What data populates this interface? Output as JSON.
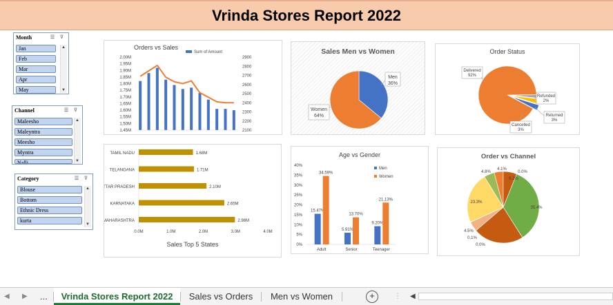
{
  "title": "Vrinda Stores Report 2022",
  "slicers": {
    "month": {
      "title": "Month",
      "items": [
        "Jan",
        "Feb",
        "Mar",
        "Apr",
        "May"
      ]
    },
    "channel": {
      "title": "Channel",
      "items": [
        "Maleesho",
        "Maleyntra",
        "Meesho",
        "Myntra",
        "Nalli"
      ]
    },
    "category": {
      "title": "Category",
      "items": [
        "Blouse",
        "Bottom",
        "Ethnic Dress",
        "kurta"
      ]
    }
  },
  "charts": {
    "orders_vs_sales": {
      "title": "Orders vs Sales",
      "legend": "Sum of Amount",
      "left_ticks": [
        "2.00M",
        "1.95M",
        "1.90M",
        "1.85M",
        "1.80M",
        "1.75M",
        "1.70M",
        "1.65M",
        "1.60M",
        "1.55M",
        "1.50M",
        "1.45M"
      ],
      "right_ticks": [
        "2900",
        "2800",
        "2700",
        "2600",
        "2500",
        "2400",
        "2300",
        "2200",
        "2100"
      ]
    },
    "sales_men_women": {
      "title": "Sales Men vs Women"
    },
    "order_status": {
      "title": "Order Status"
    },
    "top_states": {
      "title": "Sales Top 5 States",
      "x_ticks": [
        "0.0M",
        "1.0M",
        "2.0M",
        "3.0M",
        "4.0M"
      ]
    },
    "age_gender": {
      "title": "Age vs Gender",
      "y_ticks": [
        "40%",
        "35%",
        "30%",
        "25%",
        "20%",
        "15%",
        "10%",
        "5%",
        "0%"
      ]
    },
    "order_channel": {
      "title": "Order vs Channel"
    }
  },
  "chart_data": [
    {
      "type": "bar",
      "title": "Orders vs Sales",
      "categories": [
        "1",
        "2",
        "3",
        "4",
        "5",
        "6",
        "7",
        "8",
        "9",
        "10",
        "11",
        "12"
      ],
      "series": [
        {
          "name": "Sum of Amount",
          "values": [
            1.82,
            1.88,
            1.92,
            1.83,
            1.79,
            1.76,
            1.77,
            1.73,
            1.68,
            1.61,
            1.61,
            1.6
          ]
        },
        {
          "values": [
            2690,
            2750,
            2810,
            2680,
            2630,
            2610,
            2640,
            2510,
            2460,
            2410,
            2400,
            2400
          ]
        }
      ],
      "ylim": [
        1.45,
        2.0
      ],
      "y2lim": [
        2100,
        2900
      ]
    },
    {
      "type": "pie",
      "title": "Sales Men vs Women",
      "categories": [
        "Men",
        "Women"
      ],
      "values": [
        36,
        64
      ],
      "labels": [
        "36%",
        "64%"
      ],
      "colors": [
        "#4472c4",
        "#ed7d31"
      ]
    },
    {
      "type": "pie",
      "title": "Order Status",
      "categories": [
        "Delivered",
        "Refunded",
        "Returned",
        "Cancelled"
      ],
      "values": [
        92,
        2,
        3,
        3
      ],
      "labels": [
        "92%",
        "2%",
        "3%",
        "3%"
      ],
      "colors": [
        "#ed7d31",
        "#a5a5a5",
        "#ffc000",
        "#4472c4"
      ]
    },
    {
      "type": "bar",
      "title": "Sales Top 5 States",
      "categories": [
        "TAMIL NADU",
        "TELANGANA",
        "UTTAR PRADESH",
        "KARNATAKA",
        "MAHARASHTRA"
      ],
      "values": [
        1.68,
        1.71,
        2.1,
        2.65,
        2.98
      ],
      "labels": [
        "1.68M",
        "1.71M",
        "2.10M",
        "2.65M",
        "2.98M"
      ],
      "xlim": [
        0,
        4
      ],
      "color": "#bf9000"
    },
    {
      "type": "bar",
      "title": "Age vs Gender",
      "categories": [
        "Adult",
        "Senior",
        "Teenager"
      ],
      "series": [
        {
          "name": "Men",
          "values": [
            15.47,
            5.91,
            9.2
          ],
          "labels": [
            "15.47%",
            "5.91%",
            "9.20%"
          ],
          "color": "#4472c4"
        },
        {
          "name": "Women",
          "values": [
            34.59,
            13.7,
            21.13
          ],
          "labels": [
            "34.59%",
            "13.70%",
            "21.13%"
          ],
          "color": "#ed7d31"
        }
      ],
      "ylim": [
        0,
        40
      ]
    },
    {
      "type": "pie",
      "title": "Order vs Channel",
      "values": [
        35.4,
        23.0,
        4.5,
        0.1,
        0.0,
        23.3,
        4.8,
        4.1,
        0.0,
        6.2
      ],
      "labels": [
        "35.4%",
        "",
        "4.5%",
        "0.1%",
        "0.0%",
        "23.3%",
        "4.8%",
        "4.1%",
        "0.0%",
        "6.2%"
      ],
      "colors": [
        "#70ad47",
        "#c55a11",
        "#f4b183",
        "#a9d18e",
        "#264478",
        "#ffd966",
        "#9bbb59",
        "#ed7d31",
        "#5b9bd5",
        "#c55a11"
      ]
    }
  ],
  "tabs": {
    "more": "...",
    "items": [
      "Vrinda Stores Report 2022",
      "Sales vs Orders",
      "Men vs Women"
    ],
    "add": "+"
  }
}
